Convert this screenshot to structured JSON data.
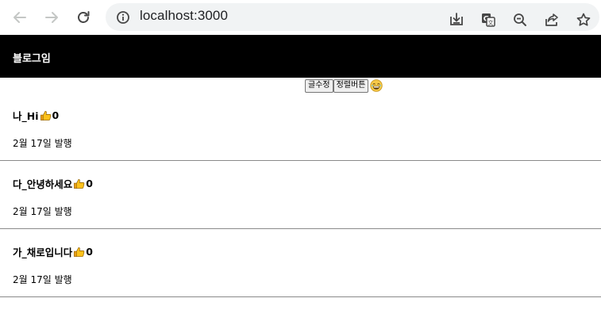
{
  "browser": {
    "url": "localhost:3000"
  },
  "header": {
    "title": "블로그임"
  },
  "buttons": {
    "edit_label": "글수정",
    "sort_label": "정렬버튼"
  },
  "posts": [
    {
      "title": "나_Hi",
      "likes": "0",
      "date": "2월 17일 발행"
    },
    {
      "title": "다_안녕하세요",
      "likes": "0",
      "date": "2월 17일 발행"
    },
    {
      "title": "가_채로입니다",
      "likes": "0",
      "date": "2월 17일 발행"
    }
  ],
  "icons": {
    "back": "back-arrow-icon",
    "forward": "forward-arrow-icon",
    "reload": "reload-icon",
    "info": "info-icon",
    "install": "install-app-icon",
    "translate": "translate-icon",
    "zoom": "zoom-out-icon",
    "share": "share-icon",
    "bookmark": "star-icon",
    "like": "thumbs-up-icon",
    "emoji": "laughing-face-icon"
  },
  "colors": {
    "header_bg": "#000000",
    "header_text": "#ffffff",
    "omnibox_bg": "#f1f3f4"
  }
}
